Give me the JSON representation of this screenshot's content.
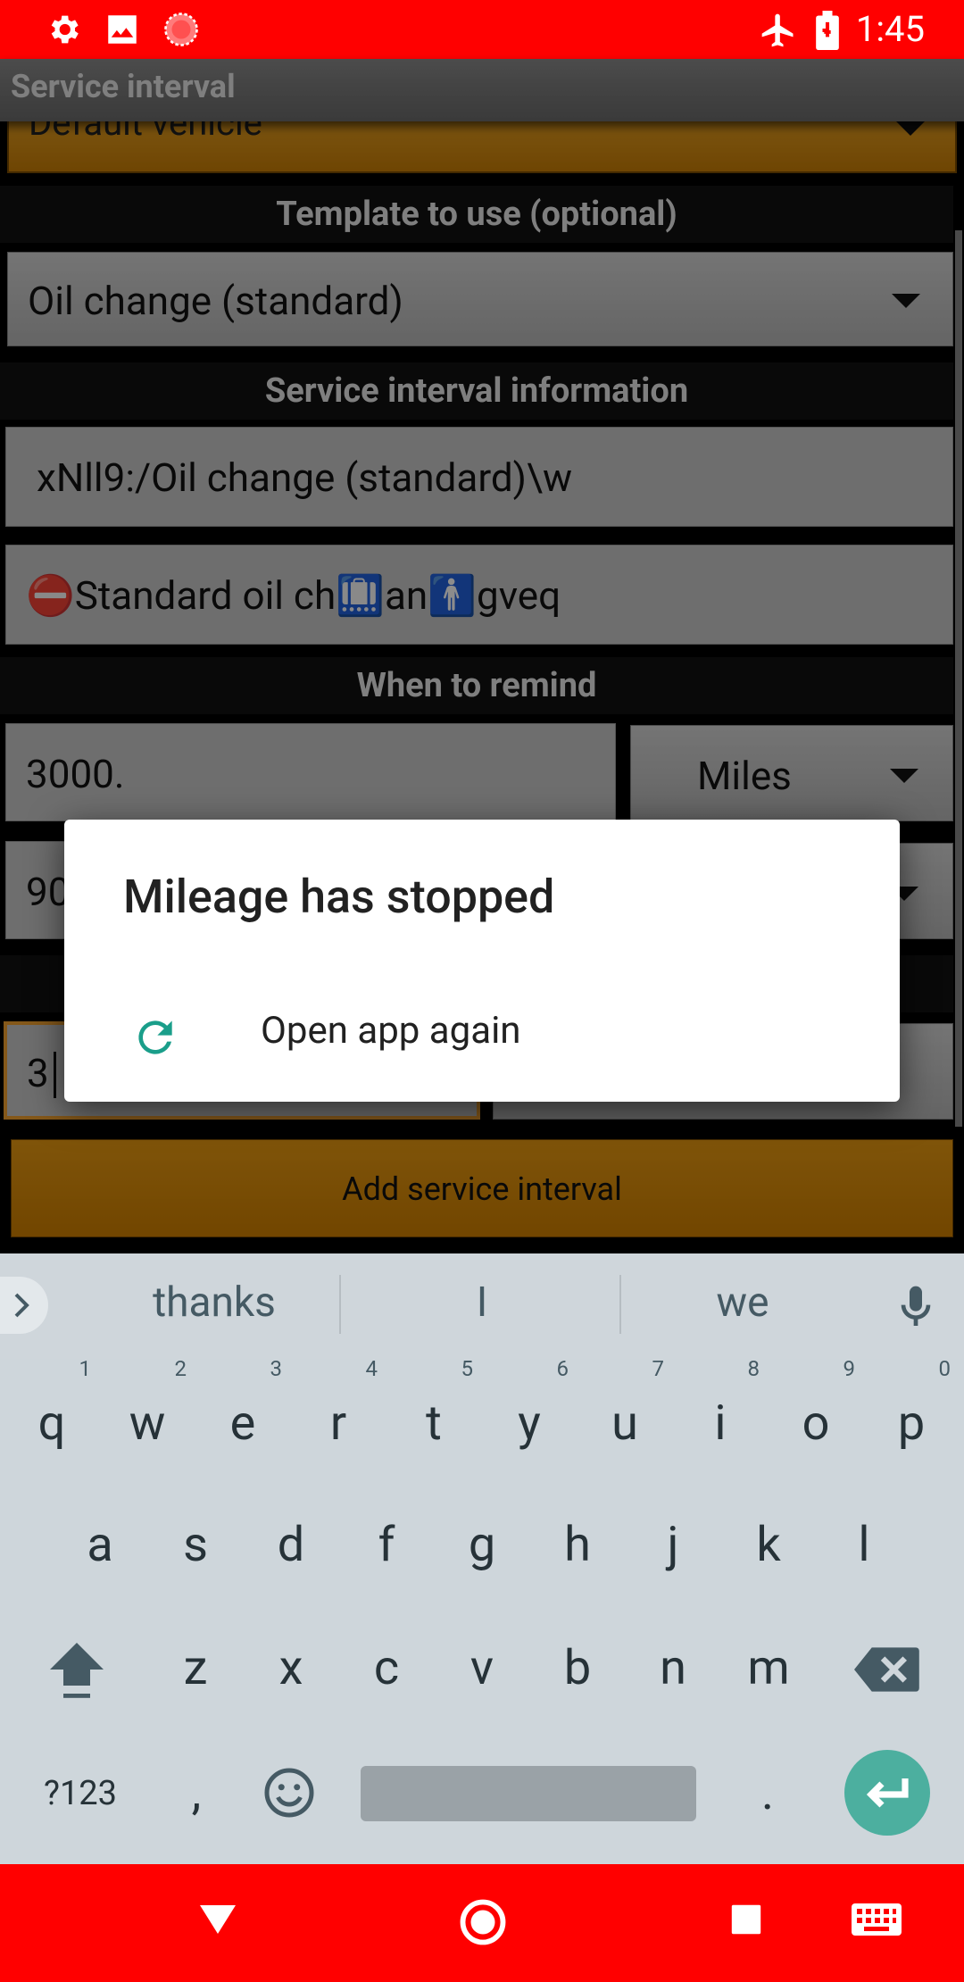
{
  "status_bar": {
    "time": "1:45"
  },
  "app_bar": {
    "title": "Service interval"
  },
  "form": {
    "vehicle_value": "Default vehicle",
    "template_header": "Template to use (optional)",
    "template_value": "Oil change (standard)",
    "info_header": "Service interval information",
    "name_value": "xNll9:/Oil change (standard)\\w",
    "description_value": "⛔Standard oil ch🛄an🚹gveq",
    "remind_header": "When to remind",
    "distance_value": "3000.",
    "distance_unit": "Miles",
    "time_value": "90",
    "third_value": "3",
    "add_button": "Add service interval"
  },
  "dialog": {
    "title": "Mileage has stopped",
    "reopen_label": "Open app again"
  },
  "keyboard": {
    "suggestions": [
      "thanks",
      "I",
      "we"
    ],
    "row1": [
      [
        "q",
        "1"
      ],
      [
        "w",
        "2"
      ],
      [
        "e",
        "3"
      ],
      [
        "r",
        "4"
      ],
      [
        "t",
        "5"
      ],
      [
        "y",
        "6"
      ],
      [
        "u",
        "7"
      ],
      [
        "i",
        "8"
      ],
      [
        "o",
        "9"
      ],
      [
        "p",
        "0"
      ]
    ],
    "row2": [
      "a",
      "s",
      "d",
      "f",
      "g",
      "h",
      "j",
      "k",
      "l"
    ],
    "row3": [
      "z",
      "x",
      "c",
      "v",
      "b",
      "n",
      "m"
    ],
    "symbols_key": "?123",
    "comma_key": ",",
    "period_key": "."
  },
  "colors": {
    "status_bar": "#ff0000",
    "accent_orange": "#e0900f",
    "dialog_icon": "#1a9e8a"
  }
}
